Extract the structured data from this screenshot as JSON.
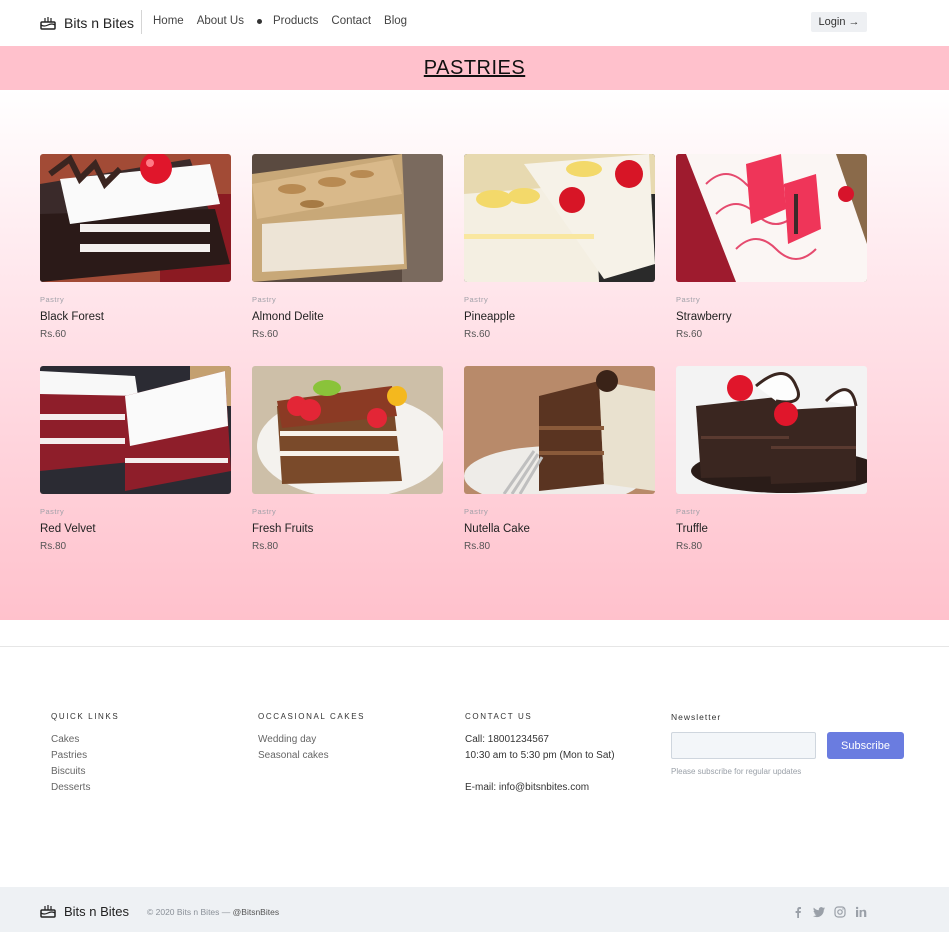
{
  "header": {
    "brand": "Bits n Bites",
    "nav": [
      {
        "label": "Home"
      },
      {
        "label": "About Us"
      },
      {
        "label": "Products"
      },
      {
        "label": "Contact"
      },
      {
        "label": "Blog"
      }
    ],
    "login_label": "Login",
    "login_arrow": "→"
  },
  "banner": {
    "title": "PASTRIES"
  },
  "products": [
    {
      "category": "Pastry",
      "name": "Black Forest",
      "price": "Rs.60"
    },
    {
      "category": "Pastry",
      "name": "Almond Delite",
      "price": "Rs.60"
    },
    {
      "category": "Pastry",
      "name": "Pineapple",
      "price": "Rs.60"
    },
    {
      "category": "Pastry",
      "name": "Strawberry",
      "price": "Rs.60"
    },
    {
      "category": "Pastry",
      "name": "Red Velvet",
      "price": "Rs.80"
    },
    {
      "category": "Pastry",
      "name": "Fresh Fruits",
      "price": "Rs.80"
    },
    {
      "category": "Pastry",
      "name": "Nutella Cake",
      "price": "Rs.80"
    },
    {
      "category": "Pastry",
      "name": "Truffle",
      "price": "Rs.80"
    }
  ],
  "footer": {
    "quick_links": {
      "title": "QUICK LINKS",
      "links": [
        "Cakes",
        "Pastries",
        "Biscuits",
        "Desserts"
      ]
    },
    "occasional": {
      "title": "OCCASIONAL CAKES",
      "links": [
        "Wedding day",
        "Seasonal cakes"
      ]
    },
    "contact": {
      "title": "CONTACT US",
      "call": "Call: 18001234567",
      "hours": "10:30 am to 5:30 pm (Mon to Sat)",
      "email": "E-mail: info@bitsnbites.com"
    },
    "newsletter": {
      "title": "Newsletter",
      "placeholder": "",
      "button": "Subscribe",
      "note": "Please subscribe for regular updates"
    }
  },
  "bottom": {
    "brand": "Bits n Bites",
    "copyright": "© 2020 Bits n Bites —",
    "handle": "@BitsnBites",
    "socials": [
      "facebook-icon",
      "twitter-icon",
      "instagram-icon",
      "linkedin-icon"
    ]
  },
  "colors": {
    "banner": "#ffc1cc",
    "subscribe": "#6a7ce0",
    "bottom_bar": "#eef1f4"
  }
}
